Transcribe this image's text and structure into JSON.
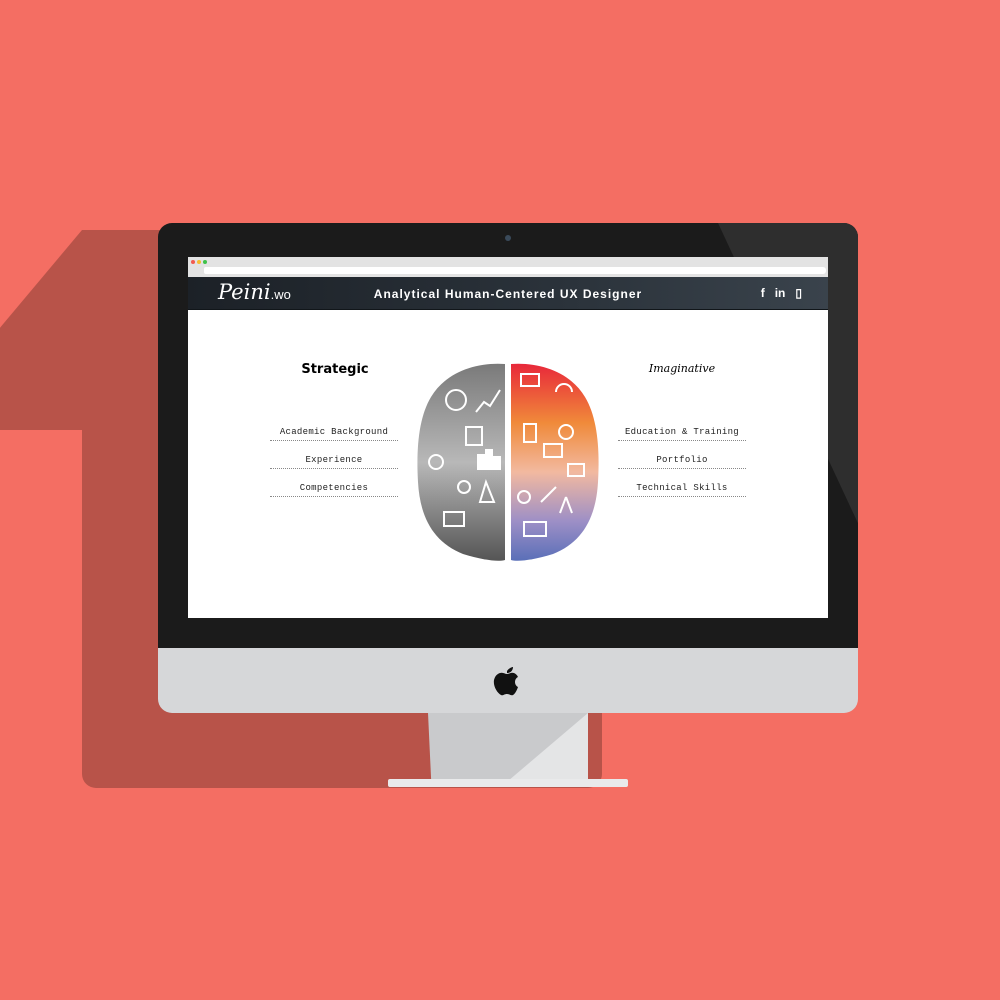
{
  "browser": {
    "url": "",
    "search": ""
  },
  "site": {
    "logo_main": "Peini",
    "logo_suffix": ".wo",
    "tagline": "Analytical Human-Centered UX Designer",
    "social": {
      "facebook": "f",
      "linkedin": "in",
      "resume": "▯"
    }
  },
  "left": {
    "heading": "Strategic",
    "links": [
      "Academic Background",
      "Experience",
      "Competencies"
    ]
  },
  "right": {
    "heading": "Imaginative",
    "links": [
      "Education & Training",
      "Portfolio",
      "Technical Skills"
    ]
  },
  "colors": {
    "background": "#f46e63",
    "accent": "#e8283a"
  }
}
